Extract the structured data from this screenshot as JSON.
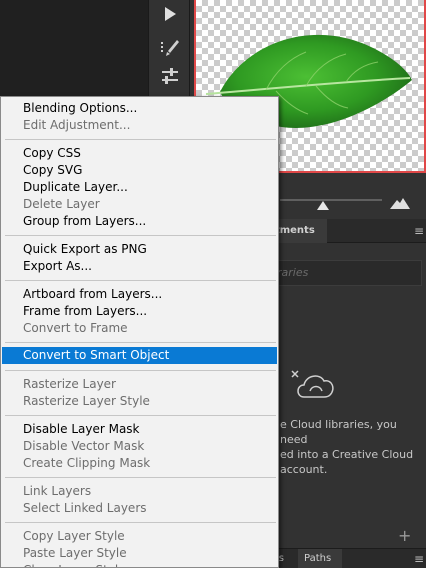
{
  "colors": {
    "menu_bg": "#f2f2f2",
    "menu_highlight": "#0a7ad4",
    "menu_disabled": "#6d6d6d",
    "panel_bg": "#323232",
    "preview_border": "#e04848",
    "leaf_green": "#3aa028"
  },
  "toolstrip": {
    "icons": [
      "play-icon",
      "brush-settings-icon",
      "adjust-sliders-icon"
    ]
  },
  "panel": {
    "tab_active": "stments",
    "libraries_placeholder": "raries",
    "message": "e Cloud libraries, you need\ned into a Creative Cloud\naccount.",
    "bottom_tab_left": "ls",
    "bottom_tab_paths": "Paths"
  },
  "context_menu": {
    "groups": [
      {
        "items": [
          {
            "label": "Blending Options...",
            "enabled": true
          },
          {
            "label": "Edit Adjustment...",
            "enabled": false
          }
        ]
      },
      {
        "items": [
          {
            "label": "Copy CSS",
            "enabled": true
          },
          {
            "label": "Copy SVG",
            "enabled": true
          },
          {
            "label": "Duplicate Layer...",
            "enabled": true
          },
          {
            "label": "Delete Layer",
            "enabled": false
          },
          {
            "label": "Group from Layers...",
            "enabled": true
          }
        ]
      },
      {
        "items": [
          {
            "label": "Quick Export as PNG",
            "enabled": true
          },
          {
            "label": "Export As...",
            "enabled": true
          }
        ]
      },
      {
        "items": [
          {
            "label": "Artboard from Layers...",
            "enabled": true
          },
          {
            "label": "Frame from Layers...",
            "enabled": true
          },
          {
            "label": "Convert to Frame",
            "enabled": false
          }
        ]
      },
      {
        "items": [
          {
            "label": "Convert to Smart Object",
            "enabled": true,
            "selected": true
          }
        ]
      },
      {
        "items": [
          {
            "label": "Rasterize Layer",
            "enabled": false
          },
          {
            "label": "Rasterize Layer Style",
            "enabled": false
          }
        ]
      },
      {
        "items": [
          {
            "label": "Disable Layer Mask",
            "enabled": true
          },
          {
            "label": "Disable Vector Mask",
            "enabled": false
          },
          {
            "label": "Create Clipping Mask",
            "enabled": false
          }
        ]
      },
      {
        "items": [
          {
            "label": "Link Layers",
            "enabled": false
          },
          {
            "label": "Select Linked Layers",
            "enabled": false
          }
        ]
      },
      {
        "items": [
          {
            "label": "Copy Layer Style",
            "enabled": false
          },
          {
            "label": "Paste Layer Style",
            "enabled": false
          },
          {
            "label": "Clear Layer Style",
            "enabled": false
          }
        ]
      }
    ]
  }
}
